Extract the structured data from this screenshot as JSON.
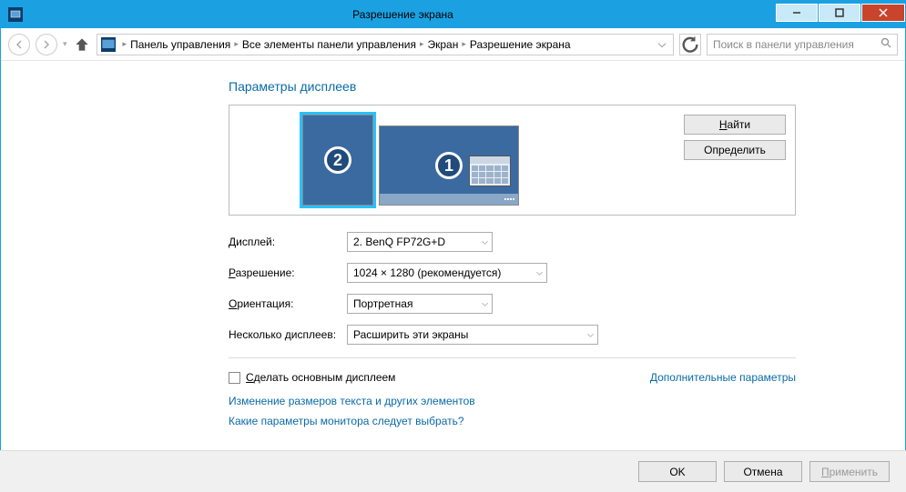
{
  "window": {
    "title": "Разрешение экрана"
  },
  "nav": {
    "breadcrumb": [
      "Панель управления",
      "Все элементы панели управления",
      "Экран",
      "Разрешение экрана"
    ],
    "search_placeholder": "Поиск в панели управления"
  },
  "heading": "Параметры дисплеев",
  "preview": {
    "monitors": [
      {
        "id": 2,
        "selected": true
      },
      {
        "id": 1,
        "selected": false
      }
    ],
    "find_button": "Найти",
    "identify_button": "Определить"
  },
  "form": {
    "display_label": "Дисплей:",
    "display_value": "2. BenQ FP72G+D",
    "resolution_label": "Разрешение:",
    "resolution_value": "1024 × 1280 (рекомендуется)",
    "orientation_label": "Ориентация:",
    "orientation_value": "Портретная",
    "multiple_label": "Несколько дисплеев:",
    "multiple_value": "Расширить эти экраны"
  },
  "checkbox": {
    "label": "Сделать основным дисплеем",
    "checked": false
  },
  "advanced_link": "Дополнительные параметры",
  "links": [
    "Изменение размеров текста и других элементов",
    "Какие параметры монитора следует выбрать?"
  ],
  "buttons": {
    "ok": "OK",
    "cancel": "Отмена",
    "apply": "Применить"
  },
  "underlines": {
    "display": "Д",
    "display_rest": "исплей:",
    "resolution": "Р",
    "resolution_rest": "азрешение:",
    "orientation": "О",
    "orientation_rest": "риентация:",
    "multiple": "д",
    "multiple_pre": "Несколько ",
    "multiple_rest": "исплеев:",
    "main": "С",
    "main_rest": "делать основным дисплеем",
    "find": "Н",
    "find_rest": "айти",
    "apply": "П",
    "apply_rest": "рименить"
  }
}
